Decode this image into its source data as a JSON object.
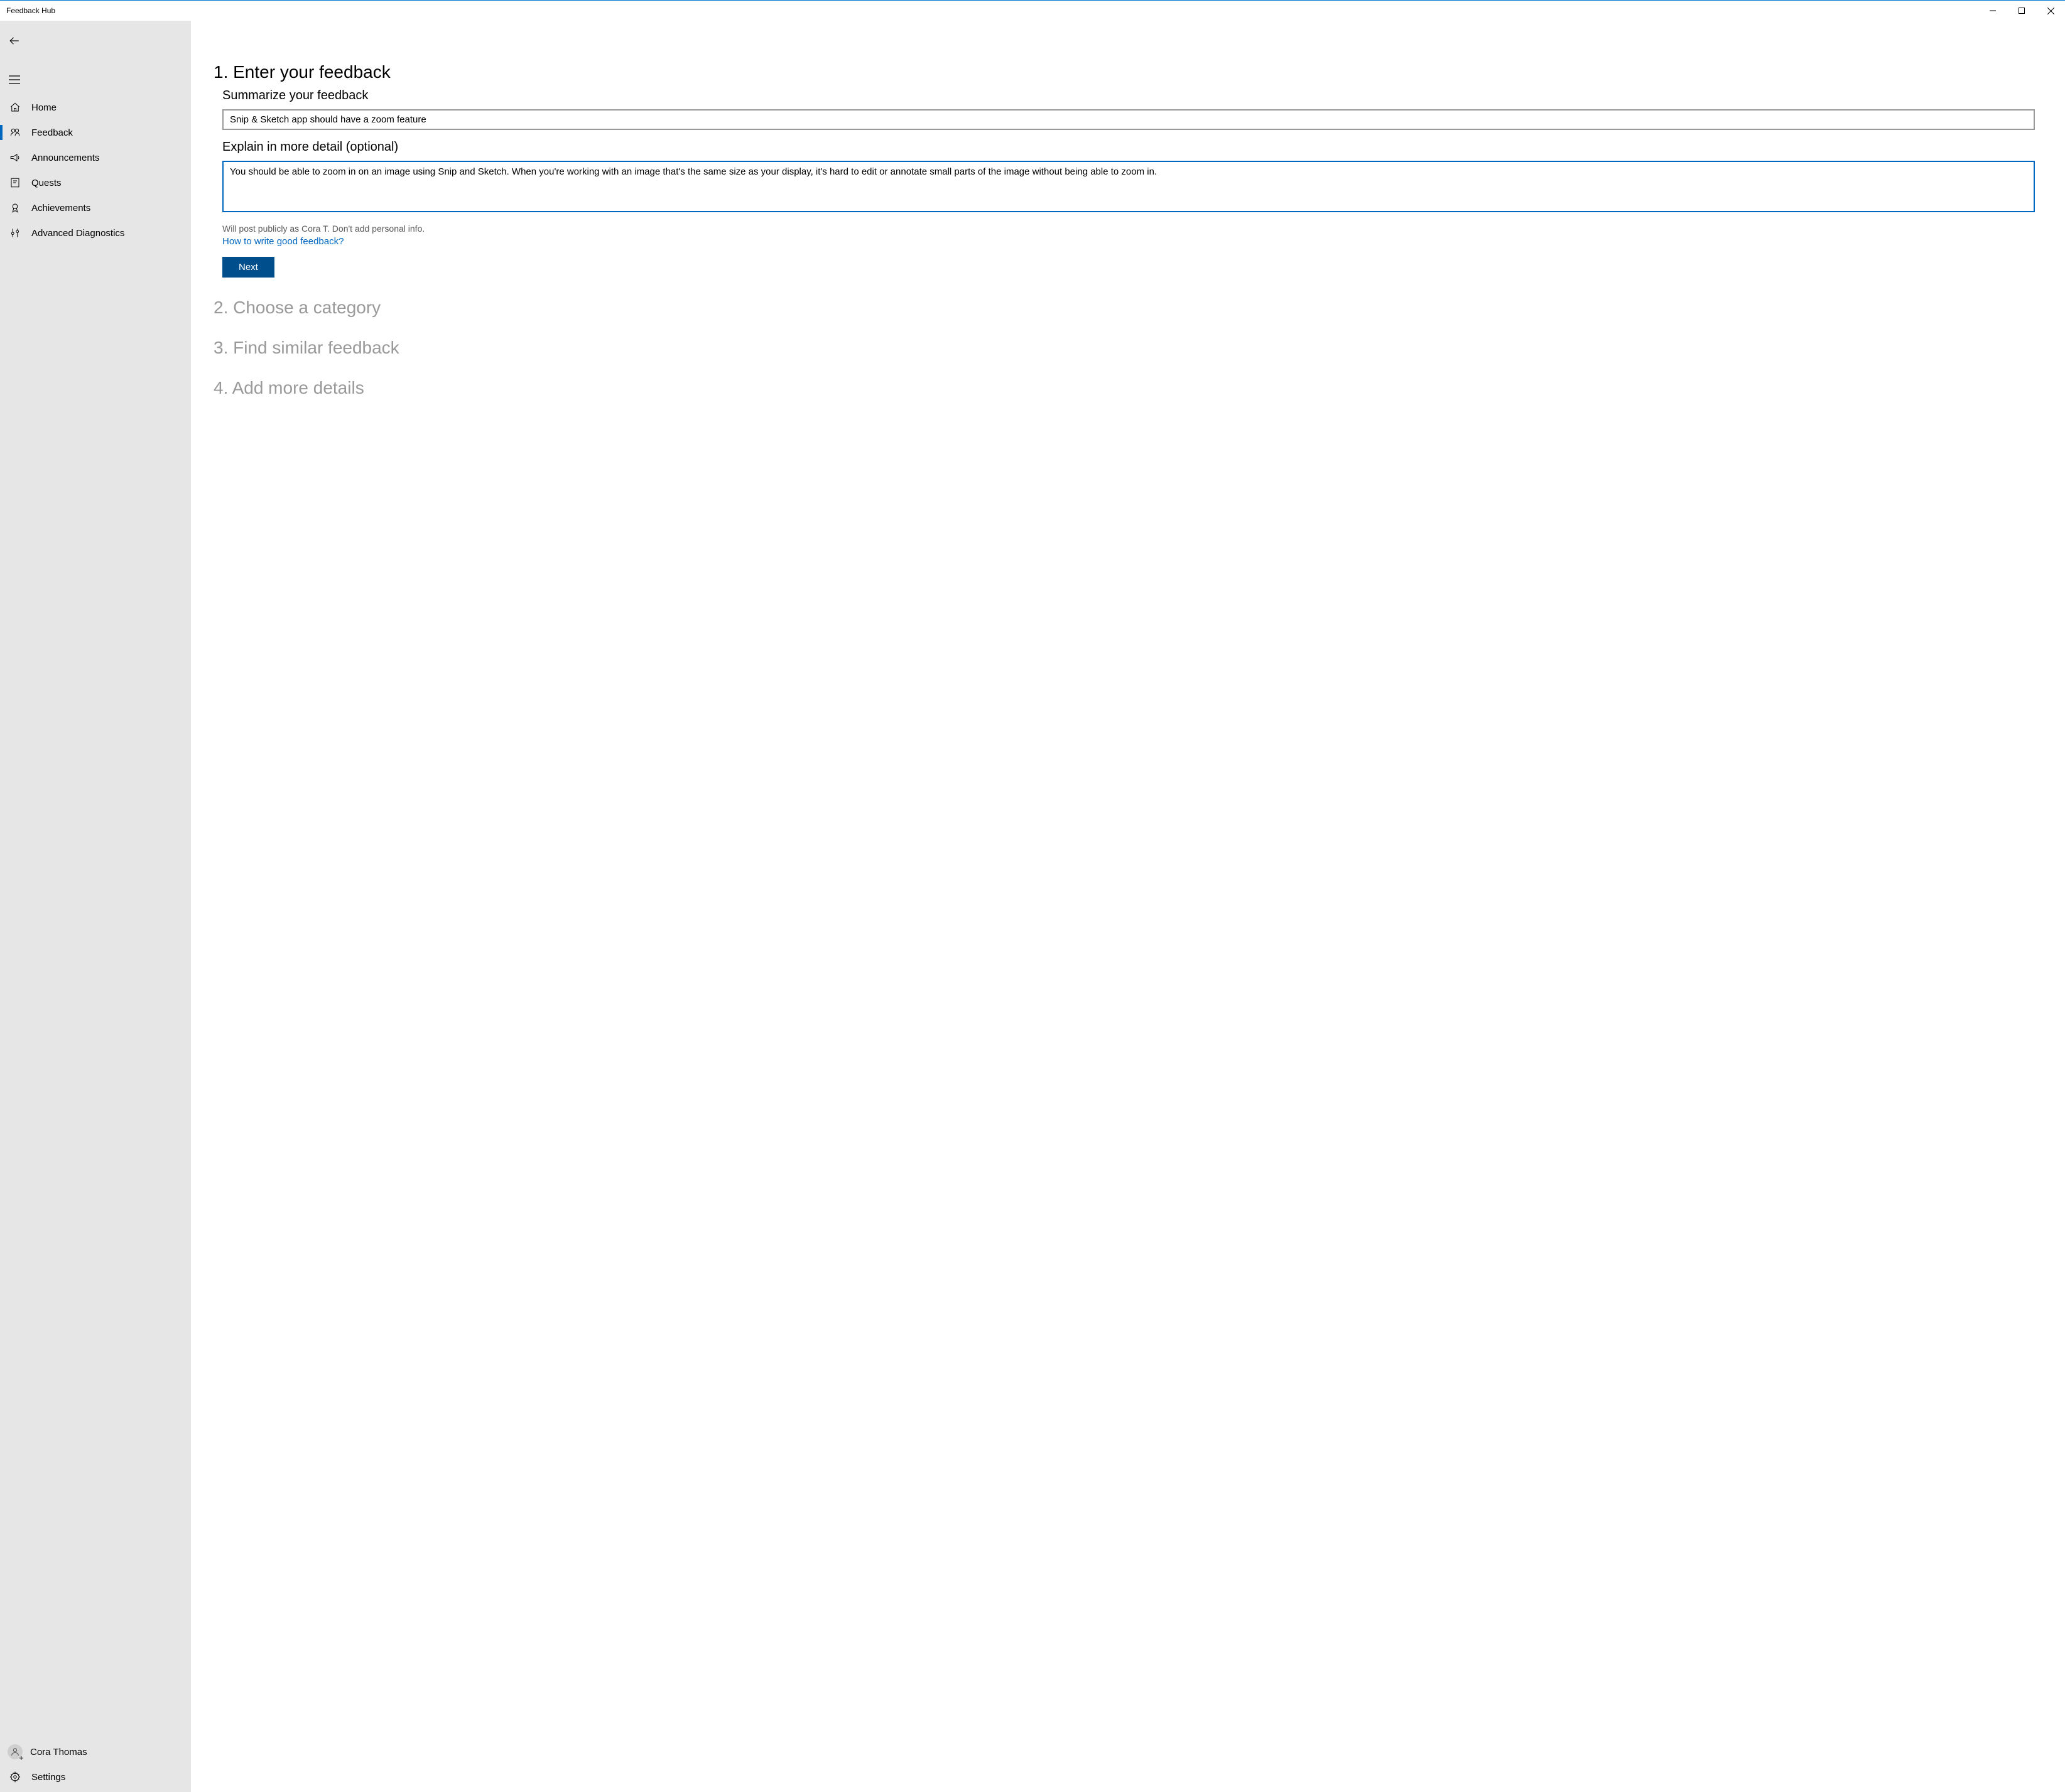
{
  "title": "Feedback Hub",
  "sidebar": {
    "items": [
      {
        "label": "Home"
      },
      {
        "label": "Feedback"
      },
      {
        "label": "Announcements"
      },
      {
        "label": "Quests"
      },
      {
        "label": "Achievements"
      },
      {
        "label": "Advanced Diagnostics"
      }
    ],
    "user": "Cora Thomas",
    "settings": "Settings"
  },
  "steps": {
    "s1": "1. Enter your feedback",
    "s2": "2. Choose a category",
    "s3": "3. Find similar feedback",
    "s4": "4. Add more details"
  },
  "form": {
    "summary_label": "Summarize your feedback",
    "summary_value": "Snip & Sketch app should have a zoom feature",
    "detail_label": "Explain in more detail (optional)",
    "detail_value": "You should be able to zoom in on an image using Snip and Sketch. When you're working with an image that's the same size as your display, it's hard to edit or annotate small parts of the image without being able to zoom in.",
    "post_hint": "Will post publicly as Cora T. Don't add personal info.",
    "good_link": "How to write good feedback?",
    "next": "Next"
  }
}
